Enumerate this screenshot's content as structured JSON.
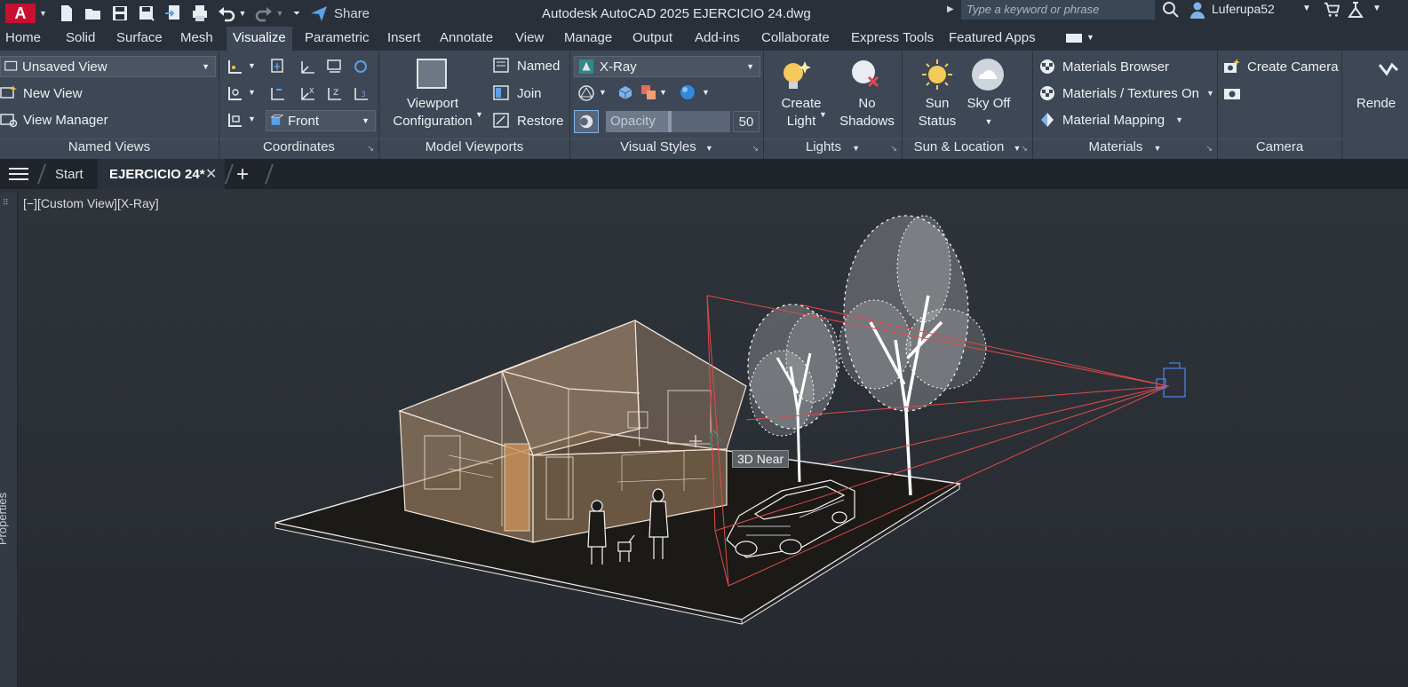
{
  "app": {
    "title": "Autodesk AutoCAD 2025    EJERCICIO 24.dwg",
    "logo": "A",
    "share_label": "Share"
  },
  "search": {
    "placeholder": "Type a keyword or phrase"
  },
  "user": {
    "name": "Luferupa52"
  },
  "ribbon_tabs": [
    "Home",
    "Solid",
    "Surface",
    "Mesh",
    "Visualize",
    "Parametric",
    "Insert",
    "Annotate",
    "View",
    "Manage",
    "Output",
    "Add-ins",
    "Collaborate",
    "Express Tools",
    "Featured Apps"
  ],
  "active_tab": "Visualize",
  "panels": {
    "named_views": {
      "title": "Named Views",
      "current_view": "Unsaved View",
      "new_view": "New View",
      "view_manager": "View Manager"
    },
    "coordinates": {
      "title": "Coordinates",
      "ucs_view": "Front"
    },
    "model_viewports": {
      "title": "Model Viewports",
      "viewport_config": [
        "Viewport",
        "Configuration"
      ],
      "named": "Named",
      "join": "Join",
      "restore": "Restore"
    },
    "visual_styles": {
      "title": "Visual Styles",
      "style": "X-Ray",
      "opacity_label": "Opacity",
      "opacity_value": "50",
      "opacity_fraction": 0.5
    },
    "lights": {
      "title": "Lights",
      "create_light": [
        "Create",
        "Light"
      ],
      "shadows": [
        "No",
        "Shadows"
      ]
    },
    "sun_location": {
      "title": "Sun & Location",
      "sun_status": [
        "Sun",
        "Status"
      ],
      "sky": "Sky Off"
    },
    "materials": {
      "title": "Materials",
      "browser": "Materials Browser",
      "textures": "Materials / Textures On",
      "mapping": "Material Mapping"
    },
    "camera": {
      "title": "Camera",
      "create_camera": "Create Camera"
    },
    "render": {
      "label": "Rende"
    }
  },
  "doc_tabs": {
    "start": "Start",
    "active": "EJERCICIO 24*"
  },
  "viewport": {
    "label": "[−][Custom View][X-Ray]",
    "tooltip": "3D Near",
    "properties_palette": "Properties"
  },
  "colors": {
    "accent": "#c8102e",
    "ribbon_bg": "#3e4755",
    "camera_frustum": "#e04a4a",
    "house_fill": "#c8a07a"
  },
  "icons": {
    "save": "save-icon",
    "undo": "undo-icon",
    "redo": "redo-icon",
    "share": "share-icon",
    "search": "search-icon",
    "user": "user-icon",
    "cart": "cart-icon",
    "help": "help-icon"
  }
}
